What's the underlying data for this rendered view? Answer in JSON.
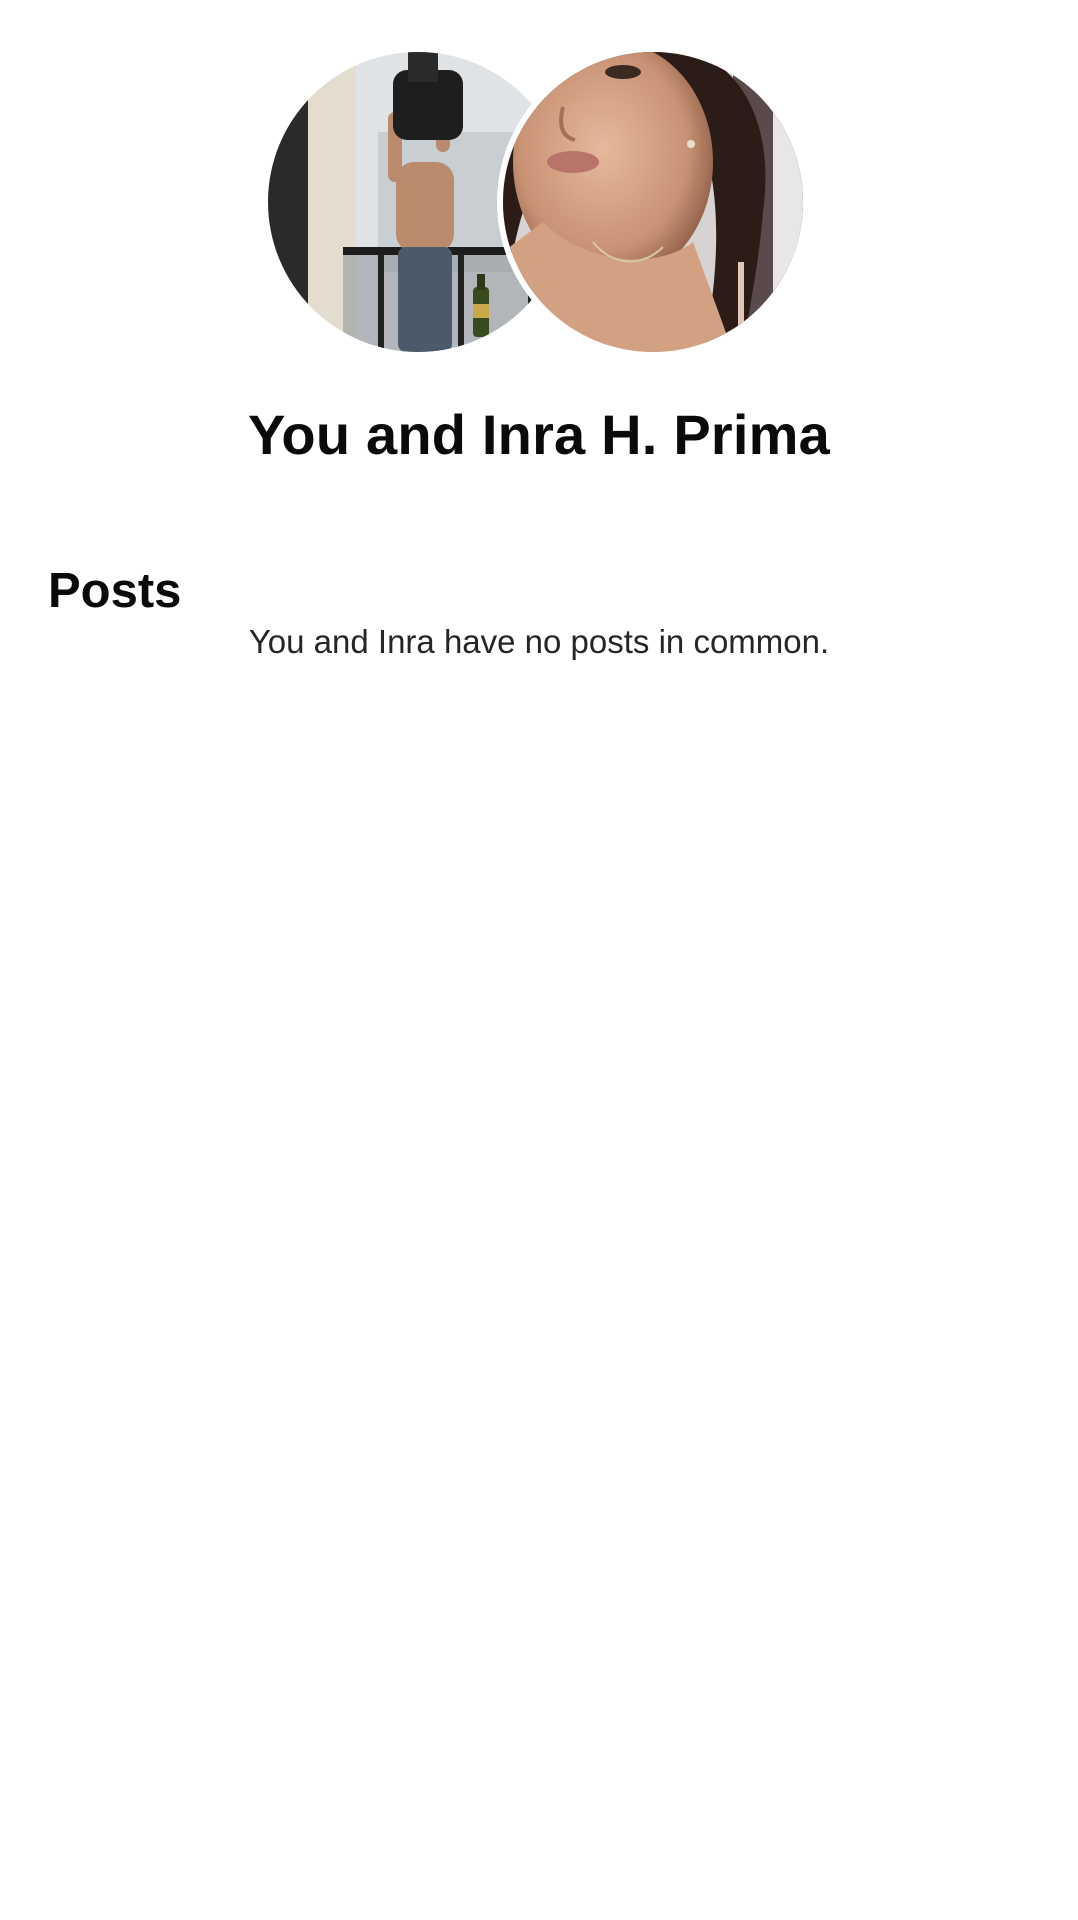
{
  "header": {
    "title": "You and Inra H. Prima"
  },
  "avatars": {
    "you": {
      "icon": "avatar-photo-you"
    },
    "other": {
      "icon": "avatar-photo-inra"
    }
  },
  "posts": {
    "heading": "Posts",
    "empty_message": "You and Inra have no posts in common."
  },
  "colors": {
    "background": "#ffffff",
    "text_primary": "#0a0a0a",
    "text_secondary": "#262626"
  }
}
